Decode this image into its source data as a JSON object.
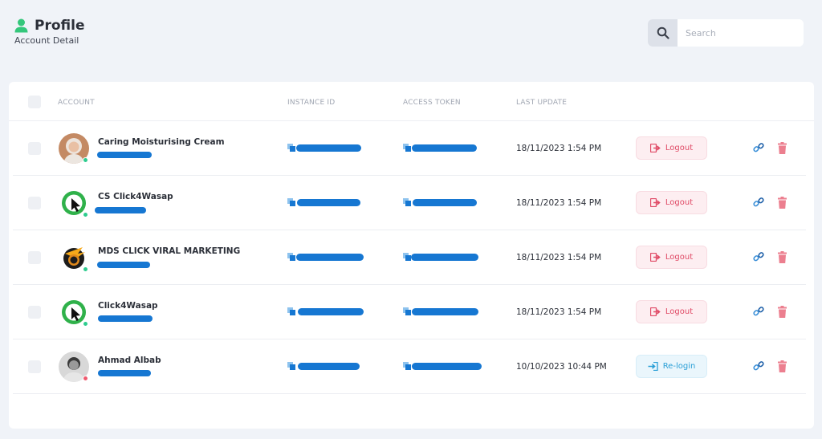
{
  "header": {
    "title": "Profile",
    "subtitle": "Account Detail"
  },
  "search": {
    "placeholder": "Search",
    "value": ""
  },
  "table": {
    "columns": [
      "ACCOUNT",
      "INSTANCE ID",
      "ACCESS TOKEN",
      "LAST UPDATE"
    ],
    "rows": [
      {
        "name": "Caring Moisturising Cream",
        "last_update": "18/11/2023 1:54 PM",
        "action": "Logout",
        "status": "online",
        "avatar": "portrait"
      },
      {
        "name": "CS Click4Wasap",
        "last_update": "18/11/2023 1:54 PM",
        "action": "Logout",
        "status": "online",
        "avatar": "whatsapp"
      },
      {
        "name": "MDS CLICK VIRAL MARKETING",
        "last_update": "18/11/2023 1:54 PM",
        "action": "Logout",
        "status": "online",
        "avatar": "ctv"
      },
      {
        "name": "Click4Wasap",
        "last_update": "18/11/2023 1:54 PM",
        "action": "Logout",
        "status": "online",
        "avatar": "whatsapp"
      },
      {
        "name": "Ahmad Albab",
        "last_update": "10/10/2023 10:44 PM",
        "action": "Re-login",
        "status": "offline",
        "avatar": "portrait-bw"
      }
    ]
  },
  "colors": {
    "accent": "#1677d2",
    "online": "#2ecc8f",
    "offline": "#ef5a6f",
    "logout": "#e04a66",
    "relogin": "#2a9fd6",
    "trash": "#ec7f8f",
    "link": "#3a8fd8"
  },
  "icons": {
    "header": "user-icon",
    "search": "search-icon",
    "copy": "copy-icon",
    "logout": "logout-icon",
    "relogin": "login-icon",
    "link": "link-icon",
    "delete": "trash-icon"
  }
}
